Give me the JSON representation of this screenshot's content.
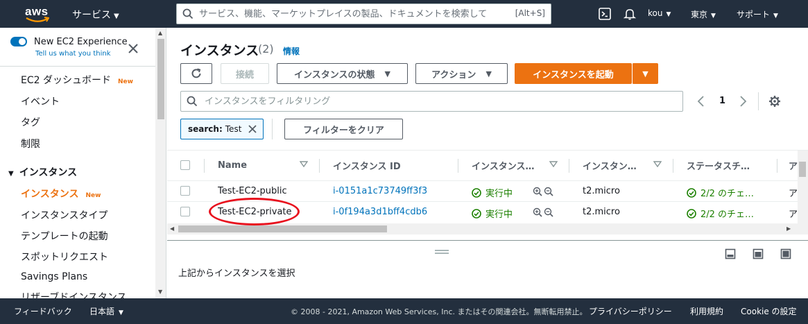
{
  "topnav": {
    "logo": "aws",
    "services_label": "サービス",
    "search_placeholder": "サービス、機能、マーケットプレイスの製品、ドキュメントを検索して",
    "search_shortcut": "[Alt+S]",
    "user": "kou",
    "region": "東京",
    "support": "サポート"
  },
  "sidebar": {
    "new_experience_title": "New EC2 Experience",
    "new_experience_sub": "Tell us what you think",
    "dashboard": "EC2 ダッシュボード",
    "dashboard_badge": "New",
    "events": "イベント",
    "tags": "タグ",
    "limits": "制限",
    "section_instances": "インスタンス",
    "instances": "インスタンス",
    "instances_badge": "New",
    "instance_types": "インスタンスタイプ",
    "launch_templates": "テンプレートの起動",
    "spot_requests": "スポットリクエスト",
    "savings_plans": "Savings Plans",
    "reserved_instances": "リザーブドインスタンス"
  },
  "main": {
    "title": "インスタンス",
    "count": "(2)",
    "info": "情報",
    "connect": "接続",
    "instance_state": "インスタンスの状態",
    "actions": "アクション",
    "launch": "インスタンスを起動",
    "filter_placeholder": "インスタンスをフィルタリング",
    "page": "1",
    "token_key": "search:",
    "token_value": "Test",
    "clear_filters": "フィルターをクリア"
  },
  "table": {
    "headers": [
      "Name",
      "インスタンス ID",
      "インスタンス…",
      "インスタン…",
      "ステータスチ…",
      "ア"
    ],
    "rows": [
      {
        "name": "Test-EC2-public",
        "id": "i-0151a1c73749ff3f3",
        "state": "実行中",
        "type": "t2.micro",
        "status": "2/2 のチェ…",
        "extra": "ア"
      },
      {
        "name": "Test-EC2-private",
        "id": "i-0f194a3d1bff4cdb6",
        "state": "実行中",
        "type": "t2.micro",
        "status": "2/2 のチェ…",
        "extra": "ア"
      }
    ]
  },
  "detail": {
    "prompt": "上記からインスタンスを選択"
  },
  "footer": {
    "feedback": "フィードバック",
    "language": "日本語",
    "copyright": "© 2008 - 2021, Amazon Web Services, Inc. またはその関連会社。無断転用禁止。",
    "privacy": "プライバシーポリシー",
    "terms": "利用規約",
    "cookies": "Cookie の設定"
  },
  "colors": {
    "nav_bg": "#232f3e",
    "accent_orange": "#ec7211",
    "link_blue": "#0073bb",
    "success_green": "#1d8102",
    "annotation_red": "#e8101d"
  }
}
